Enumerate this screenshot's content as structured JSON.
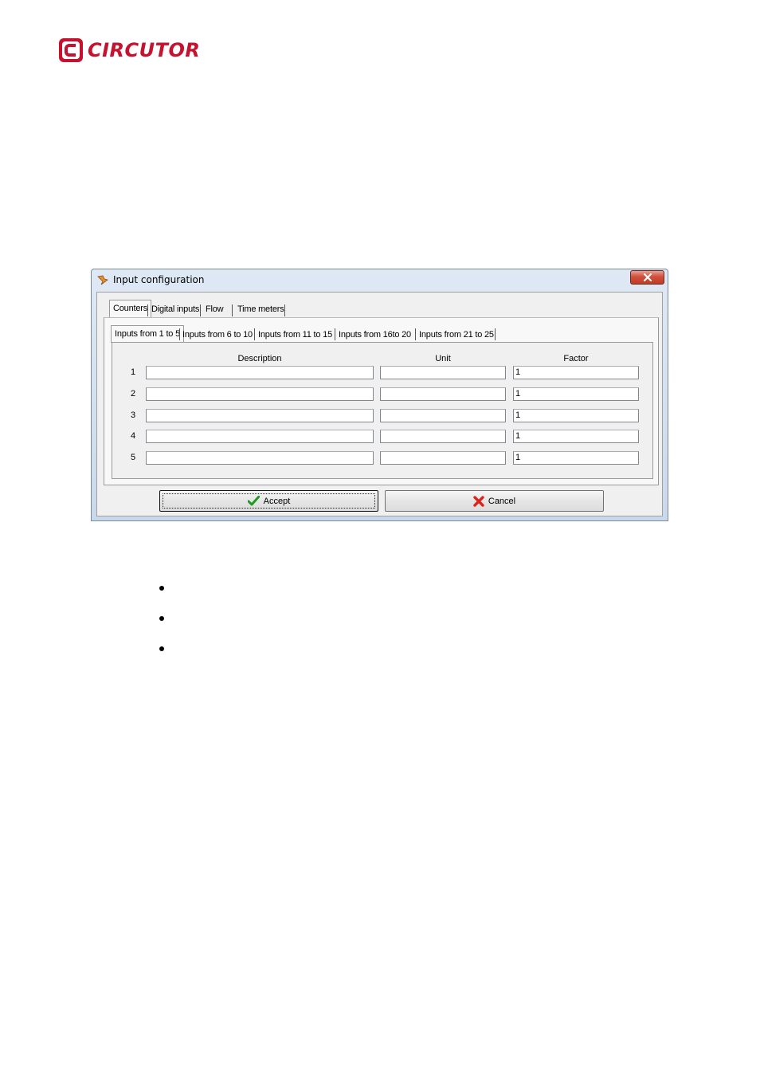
{
  "logo": {
    "text": "CIRCUTOR",
    "color": "#c4122f"
  },
  "window": {
    "title": "Input configuration",
    "close_icon": "close-x-icon",
    "outer_tabs": [
      {
        "label": "Counters",
        "selected": true
      },
      {
        "label": "Digital inputs",
        "selected": false
      },
      {
        "label": "Flow",
        "selected": false
      },
      {
        "label": "Time meters",
        "selected": false
      }
    ],
    "inner_tabs": [
      {
        "label": "Inputs from  1 to 5",
        "selected": true
      },
      {
        "label": "Inputs from 6 to 10",
        "selected": false
      },
      {
        "label": "Inputs from 11 to 15",
        "selected": false
      },
      {
        "label": "Inputs from 16to 20",
        "selected": false
      },
      {
        "label": "Inputs from 21 to 25",
        "selected": false
      }
    ],
    "columns": {
      "description": "Description",
      "unit": "Unit",
      "factor": "Factor"
    },
    "rows": [
      {
        "num": "1",
        "description": "",
        "unit": "",
        "factor": "1"
      },
      {
        "num": "2",
        "description": "",
        "unit": "",
        "factor": "1"
      },
      {
        "num": "3",
        "description": "",
        "unit": "",
        "factor": "1"
      },
      {
        "num": "4",
        "description": "",
        "unit": "",
        "factor": "1"
      },
      {
        "num": "5",
        "description": "",
        "unit": "",
        "factor": "1"
      }
    ],
    "buttons": {
      "accept": "Accept",
      "cancel": "Cancel"
    }
  },
  "bullets": [
    "",
    "",
    ""
  ]
}
